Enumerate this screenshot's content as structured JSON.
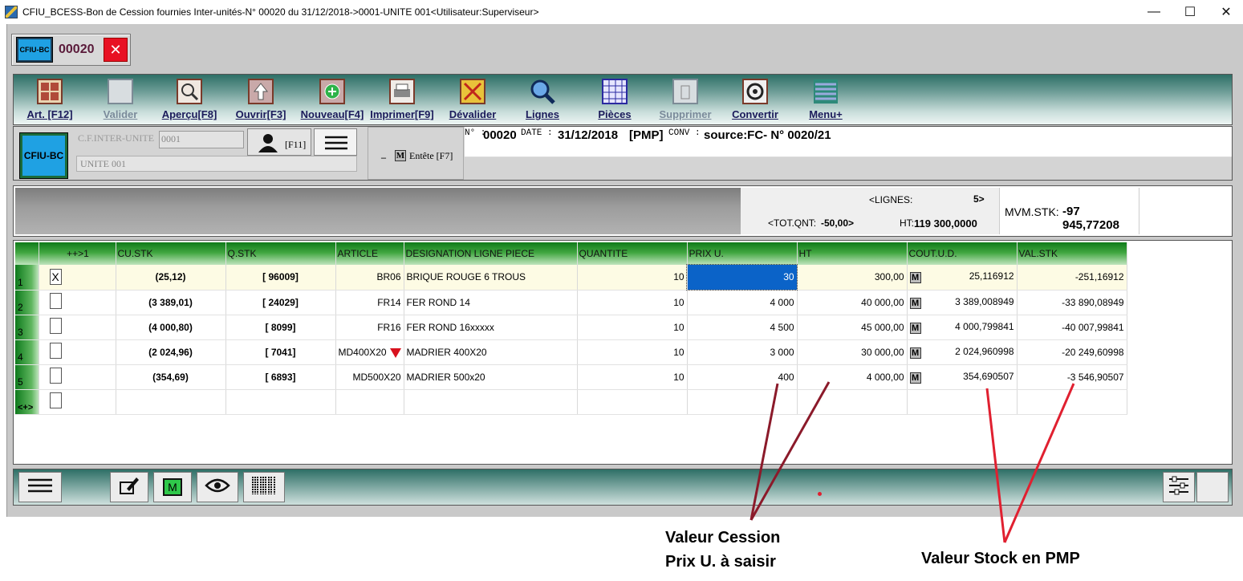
{
  "window": {
    "title": "CFIU_BCESS-Bon de Cession fournies Inter-unités-N° 00020 du 31/12/2018->0001-UNITE 001<Utilisateur:Superviseur>",
    "minimize": "—",
    "maximize": "☐",
    "close": "✕"
  },
  "tab": {
    "icon_label": "CFIU-BC",
    "number": "00020",
    "close": "✕"
  },
  "toolbar": [
    {
      "label": "Art. [F12]",
      "icon": "grid-icon",
      "enabled": true
    },
    {
      "label": "Valider",
      "icon": "validate-icon",
      "enabled": false
    },
    {
      "label": "Aperçu[F8]",
      "icon": "preview-icon",
      "enabled": true
    },
    {
      "label": "Ouvrir[F3]",
      "icon": "open-icon",
      "enabled": true
    },
    {
      "label": "Nouveau[F4]",
      "icon": "new-icon",
      "enabled": true
    },
    {
      "label": "Imprimer[F9]",
      "icon": "print-icon",
      "enabled": true
    },
    {
      "label": "Dévalider",
      "icon": "unvalidate-icon",
      "enabled": true
    },
    {
      "label": "Lignes",
      "icon": "magnifier-icon",
      "enabled": true
    },
    {
      "label": "Pièces",
      "icon": "pieces-icon",
      "enabled": true
    },
    {
      "label": "Supprimer",
      "icon": "delete-icon",
      "enabled": false
    },
    {
      "label": "Convertir",
      "icon": "convert-icon",
      "enabled": true
    },
    {
      "label": "Menu+",
      "icon": "menu-icon",
      "enabled": true
    }
  ],
  "header": {
    "big_label": "CFIU-BC",
    "cf_label": "C.F.INTER-UNITE",
    "cf_code": "0001",
    "cf_name": "UNITE 001",
    "f11": "[F11]",
    "entete_m": "M",
    "entete_label": "Entête [F7]",
    "n_label": "N° :",
    "n_value": "00020",
    "date_label": "DATE :",
    "date_value": "31/12/2018",
    "pmp": "[PMP]",
    "conv_label": "CONV :",
    "conv_value": "source:FC- N° 0020/21"
  },
  "totals": {
    "lignes_label": "<LIGNES:",
    "lignes_value": "5>",
    "totqnt_label": "<TOT.QNT:",
    "totqnt_value": "-50,00>",
    "ht_label": "HT:",
    "ht_value": "119 300,0000",
    "mvm_label": "MVM.STK:",
    "mvm_value": "-97 945,77208"
  },
  "grid": {
    "columns": [
      "",
      "++>1",
      "CU.STK",
      "Q.STK",
      "ARTICLE",
      "DESIGNATION LIGNE PIECE",
      "QUANTITE",
      "PRIX U.",
      "HT",
      "COUT.U.D.",
      "VAL.STK"
    ],
    "rows": [
      {
        "n": "1",
        "check": "X",
        "custk": "(25,12)",
        "qstk": "[ 96009]",
        "article": "BR06",
        "designation": "BRIQUE ROUGE 6 TROUS",
        "quantite": "10",
        "prix": "30",
        "ht": "300,00",
        "m": "M",
        "cout": "25,116912",
        "val": "-251,16912"
      },
      {
        "n": "2",
        "check": "",
        "custk": "(3 389,01)",
        "qstk": "[ 24029]",
        "article": "FR14",
        "designation": "FER ROND 14",
        "quantite": "10",
        "prix": "4 000",
        "ht": "40 000,00",
        "m": "M",
        "cout": "3 389,008949",
        "val": "-33 890,08949"
      },
      {
        "n": "3",
        "check": "",
        "custk": "(4 000,80)",
        "qstk": "[ 8099]",
        "article": "FR16",
        "designation": "FER ROND 16xxxxx",
        "quantite": "10",
        "prix": "4 500",
        "ht": "45 000,00",
        "m": "M",
        "cout": "4 000,799841",
        "val": "-40 007,99841"
      },
      {
        "n": "4",
        "check": "",
        "custk": "(2 024,96)",
        "qstk": "[ 7041]",
        "article": "MD400X20",
        "designation": "MADRIER 400X20",
        "quantite": "10",
        "prix": "3 000",
        "ht": "30 000,00",
        "m": "M",
        "cout": "2 024,960998",
        "val": "-20 249,60998"
      },
      {
        "n": "5",
        "check": "",
        "custk": "(354,69)",
        "qstk": "[ 6893]",
        "article": "MD500X20",
        "designation": "MADRIER 500x20",
        "quantite": "10",
        "prix": "400",
        "ht": "4 000,00",
        "m": "M",
        "cout": "354,690507",
        "val": "-3 546,90507"
      }
    ],
    "new_row_label": "<+>"
  },
  "bottom": {
    "m": "M"
  },
  "annotations": {
    "cession_line1": "Valeur Cession",
    "cession_line2": "Prix U. à saisir",
    "stock": "Valeur Stock en PMP"
  },
  "colors": {
    "accent_green": "#3fa53f",
    "selection": "#0b63c8",
    "arrow_dark": "#8b1a2a",
    "arrow_red": "#e02030"
  }
}
